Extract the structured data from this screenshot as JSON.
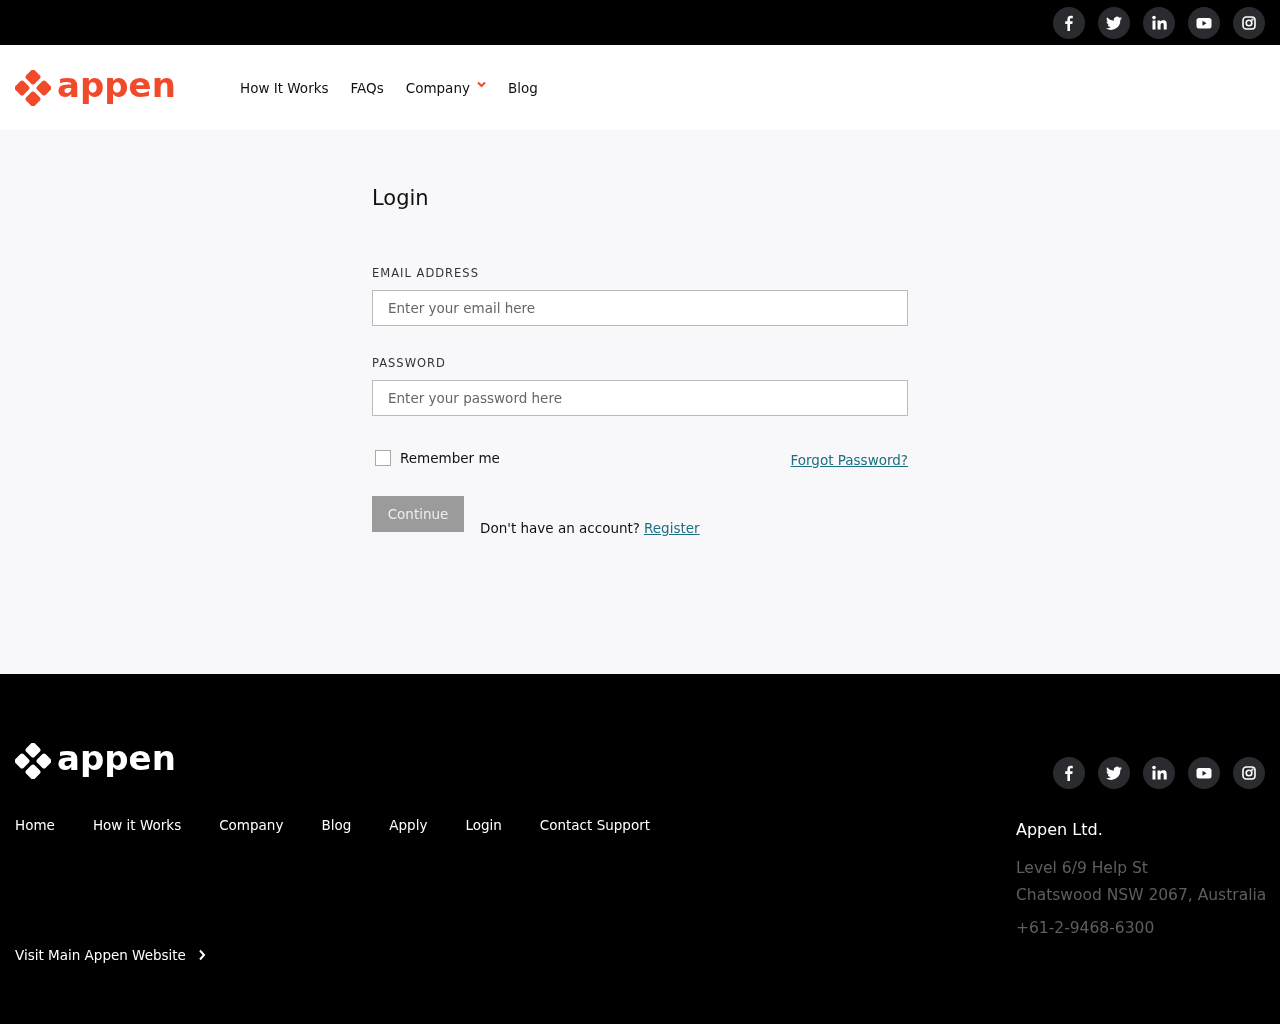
{
  "top_bar": {
    "social": [
      {
        "kind": "facebook"
      },
      {
        "kind": "twitter"
      },
      {
        "kind": "linkedin"
      },
      {
        "kind": "youtube"
      },
      {
        "kind": "instagram"
      }
    ]
  },
  "header": {
    "logo": "appen",
    "nav": [
      {
        "label": "How It Works",
        "has_menu": false
      },
      {
        "label": "FAQs",
        "has_menu": false
      },
      {
        "label": "Company",
        "has_menu": true
      },
      {
        "label": "Blog",
        "has_menu": false
      }
    ]
  },
  "login": {
    "title": "Login",
    "email": {
      "label": "EMAIL ADDRESS",
      "placeholder": "Enter your email here"
    },
    "password": {
      "label": "PASSWORD",
      "placeholder": "Enter your password here"
    },
    "remember": {
      "label": "Remember me",
      "checked": false
    },
    "forgot": "Forgot Password?",
    "continue": {
      "label": "Continue",
      "disabled": true
    },
    "prompt": "Don't have an account?",
    "register": "Register"
  },
  "footer": {
    "logo": "appen",
    "social": [
      {
        "kind": "facebook"
      },
      {
        "kind": "twitter"
      },
      {
        "kind": "linkedin"
      },
      {
        "kind": "youtube"
      },
      {
        "kind": "instagram"
      }
    ],
    "links": [
      "Home",
      "How it Works",
      "Company",
      "Blog",
      "Apply",
      "Login",
      "Contact Support"
    ],
    "visit": "Visit Main Appen Website",
    "company": {
      "name": "Appen Ltd.",
      "address": [
        "Level 6/9 Help St",
        "Chatswood NSW 2067, Australia"
      ],
      "phone": "+61-2-9468-6300"
    }
  }
}
